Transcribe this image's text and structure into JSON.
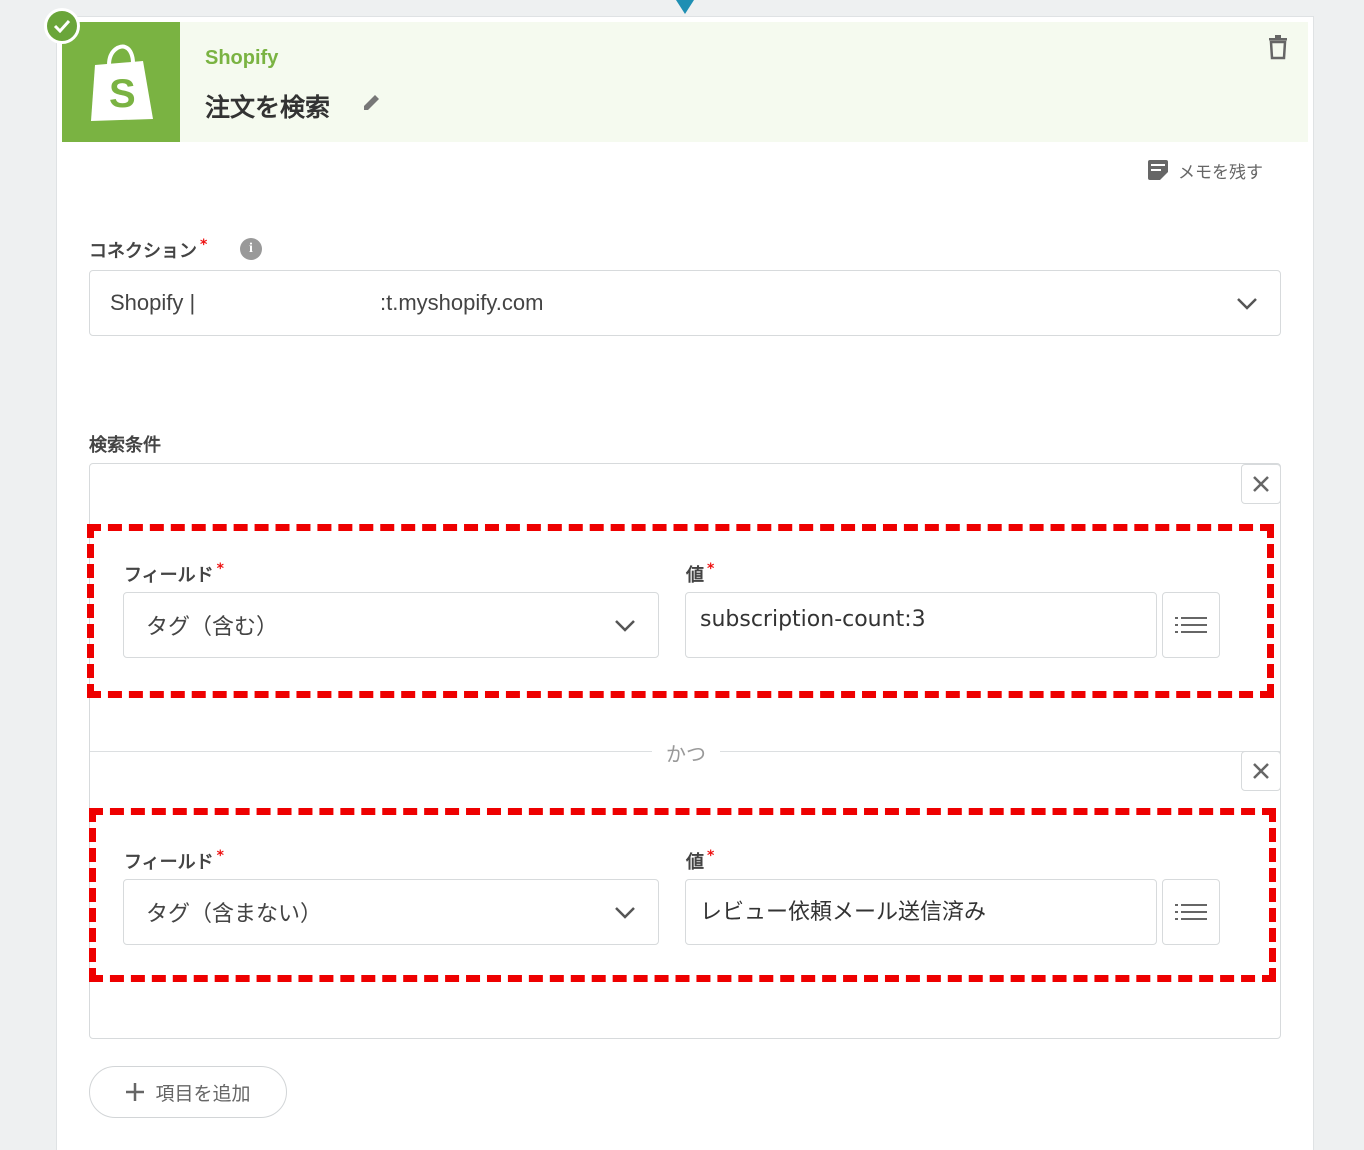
{
  "step": {
    "app_name": "Shopify",
    "title": "注文を検索",
    "memo_label": "メモを残す"
  },
  "connection": {
    "label": "コネクション",
    "required_mark": "*",
    "value_prefix": "Shopify |",
    "value_suffix": ":t.myshopify.com"
  },
  "search": {
    "label": "検索条件",
    "conjunction": "かつ",
    "conditions": [
      {
        "field_label": "フィールド",
        "field_value": "タグ（含む）",
        "value_label": "値",
        "value": "subscription-count:3"
      },
      {
        "field_label": "フィールド",
        "field_value": "タグ（含まない）",
        "value_label": "値",
        "value": "レビュー依頼メール送信済み"
      }
    ],
    "add_item_label": "項目を追加"
  },
  "colors": {
    "shopify_green": "#7ab342",
    "header_bg": "#f5faef",
    "highlight_red": "#ee0000",
    "flow_arrow": "#1f8fb3"
  },
  "icons": [
    "check-icon",
    "shopify-bag-icon",
    "pencil-icon",
    "trash-icon",
    "memo-icon",
    "info-icon",
    "chevron-down-icon",
    "close-icon",
    "list-icon",
    "plus-icon"
  ]
}
